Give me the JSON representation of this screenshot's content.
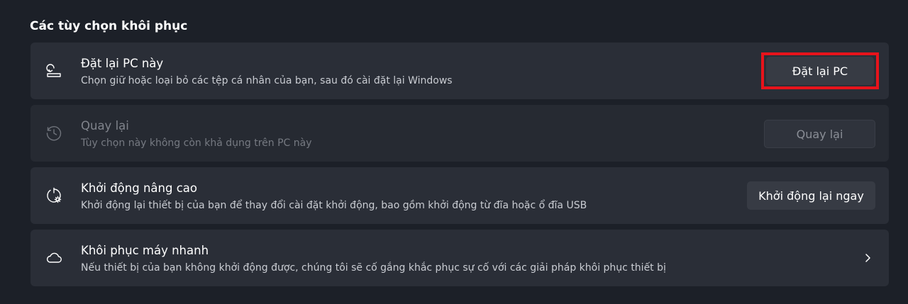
{
  "section_title": "Các tùy chọn khôi phục",
  "cards": [
    {
      "icon": "reset-pc-icon",
      "title": "Đặt lại PC này",
      "subtitle": "Chọn giữ hoặc loại bỏ các tệp cá nhân của bạn, sau đó cài đặt lại Windows",
      "button_label": "Đặt lại PC",
      "enabled": true,
      "highlighted": true
    },
    {
      "icon": "history-icon",
      "title": "Quay lại",
      "subtitle": "Tùy chọn này không còn khả dụng trên PC này",
      "button_label": "Quay lại",
      "enabled": false
    },
    {
      "icon": "advanced-startup-icon",
      "title": "Khởi động nâng cao",
      "subtitle": "Khởi động lại thiết bị của bạn để thay đổi cài đặt khởi động, bao gồm khởi động từ đĩa hoặc ổ đĩa USB",
      "button_label": "Khởi động lại ngay",
      "enabled": true
    },
    {
      "icon": "cloud-icon",
      "title": "Khôi phục máy nhanh",
      "subtitle": "Nếu thiết bị của bạn không khởi động được, chúng tôi sẽ cố gắng khắc phục sự cố với các giải pháp khôi phục thiết bị",
      "action_icon": "chevron-right-icon",
      "enabled": true
    }
  ],
  "colors": {
    "background": "#1c2028",
    "card": "#2a2e37",
    "button": "#373b44",
    "highlight": "#e8131b"
  }
}
